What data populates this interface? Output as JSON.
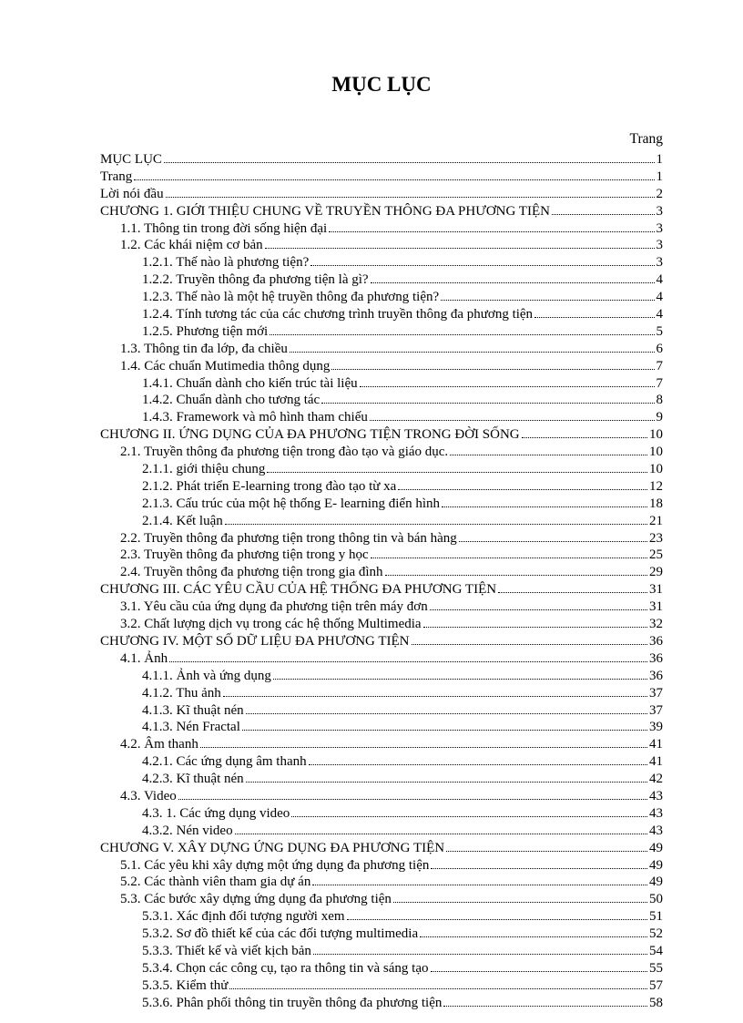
{
  "title": "MỤC LỤC",
  "page_label": "Trang",
  "entries": [
    {
      "label": "MỤC LỤC",
      "page": "1",
      "level": 0
    },
    {
      "label": "Trang ",
      "page": "1",
      "level": 0
    },
    {
      "label": "Lời nói đầu ",
      "page": "2",
      "level": 0
    },
    {
      "label": "CHƯƠNG 1. GIỚI THIỆU CHUNG VỀ TRUYỀN THÔNG ĐA PHƯƠNG TIỆN ",
      "page": "3",
      "level": 0
    },
    {
      "label": "1.1. Thông tin trong đời sống hiện đại ",
      "page": "3",
      "level": 1
    },
    {
      "label": "1.2. Các khái niệm cơ bản ",
      "page": "3",
      "level": 1
    },
    {
      "label": "1.2.1. Thế nào là phương tiện? ",
      "page": "3",
      "level": 2
    },
    {
      "label": "1.2.2. Truyền thông đa phương tiện là gì?",
      "page": "4",
      "level": 2
    },
    {
      "label": "1.2.3. Thế nào là một hệ truyền thông đa phương tiện? ",
      "page": "4",
      "level": 2
    },
    {
      "label": "1.2.4. Tính tương tác của các chương trình truyền thông đa phương tiện ",
      "page": "4",
      "level": 2
    },
    {
      "label": "1.2.5. Phương tiện mới ",
      "page": "5",
      "level": 2
    },
    {
      "label": "1.3. Thông tin đa lớp, đa chiều ",
      "page": "6",
      "level": 1
    },
    {
      "label": "1.4. Các chuẩn Mutimedia thông dụng ",
      "page": "7",
      "level": 1
    },
    {
      "label": "1.4.1. Chuẩn dành cho kiến trúc tài liệu ",
      "page": "7",
      "level": 2
    },
    {
      "label": "1.4.2. Chuẩn dành cho tương tác ",
      "page": "8",
      "level": 2
    },
    {
      "label": "1.4.3. Framework và mô hình tham chiếu ",
      "page": "9",
      "level": 2
    },
    {
      "label": "CHƯƠNG II. ỨNG DỤNG CỦA ĐA PHƯƠNG TIỆN TRONG ĐỜI SỐNG",
      "page": "10",
      "level": 0
    },
    {
      "label": "2.1. Truyền thông đa phương tiện trong đào tạo và giáo dục. ",
      "page": "10",
      "level": 1
    },
    {
      "label": "2.1.1. giới thiệu chung ",
      "page": "10",
      "level": 2
    },
    {
      "label": "2.1.2. Phát triển E-learning trong đào tạo từ xa ",
      "page": "12",
      "level": 2
    },
    {
      "label": "2.1.3. Cấu trúc của một hệ thống E- learning điển hình ",
      "page": "18",
      "level": 2
    },
    {
      "label": "2.1.4. Kết luận ",
      "page": "21",
      "level": 2
    },
    {
      "label": "2.2. Truyền thông đa phương tiện trong thông tin và bán hàng ",
      "page": "23",
      "level": 1
    },
    {
      "label": "2.3. Truyền thông đa phương tiện trong y học",
      "page": "25",
      "level": 1
    },
    {
      "label": "2.4. Truyền thông đa phương tiện trong gia đình ",
      "page": "29",
      "level": 1
    },
    {
      "label": "CHƯƠNG III. CÁC YÊU CẦU CỦA HỆ THỐNG ĐA PHƯƠNG TIỆN ",
      "page": "31",
      "level": 0
    },
    {
      "label": "3.1. Yêu cầu của ứng dụng đa phương tiện trên máy đơn ",
      "page": "31",
      "level": 1
    },
    {
      "label": "3.2. Chất lượng dịch vụ trong các hệ thống Multimedia",
      "page": "32",
      "level": 1
    },
    {
      "label": "CHƯƠNG IV. MỘT SỐ DỮ LIỆU ĐA PHƯƠNG TIỆN",
      "page": "36",
      "level": 0
    },
    {
      "label": "4.1. Ảnh ",
      "page": "36",
      "level": 1
    },
    {
      "label": "4.1.1. Ảnh và ứng dụng ",
      "page": "36",
      "level": 2
    },
    {
      "label": "4.1.2. Thu ảnh ",
      "page": "37",
      "level": 2
    },
    {
      "label": "4.1.3. Kĩ thuật nén ",
      "page": "37",
      "level": 2
    },
    {
      "label": "4.1.3. Nén Fractal ",
      "page": "39",
      "level": 2
    },
    {
      "label": "4.2. Âm thanh",
      "page": "41",
      "level": 1
    },
    {
      "label": "4.2.1. Các ứng dụng âm thanh ",
      "page": "41",
      "level": 2
    },
    {
      "label": "4.2.3. Kĩ thuật nén ",
      "page": "42",
      "level": 2
    },
    {
      "label": "4.3. Video ",
      "page": "43",
      "level": 1
    },
    {
      "label": "4.3. 1.  Các ứng dụng video",
      "page": "43",
      "level": 2
    },
    {
      "label": "4.3.2. Nén video",
      "page": "43",
      "level": 2
    },
    {
      "label": "CHƯƠNG V. XÂY DỰNG ỨNG DỤNG ĐA PHƯƠNG TIỆN ",
      "page": "49",
      "level": 0
    },
    {
      "label": "5.1. Các yêu khi xây dựng một ứng dụng đa phương tiện ",
      "page": "49",
      "level": 1
    },
    {
      "label": "5.2. Các thành viên tham gia dự án",
      "page": "49",
      "level": 1
    },
    {
      "label": "5.3. Các bước xây dựng ứng dụng đa phương tiện ",
      "page": "50",
      "level": 1
    },
    {
      "label": "5.3.1. Xác định đối tượng người xem ",
      "page": "51",
      "level": 2
    },
    {
      "label": "5.3.2. Sơ đồ thiết kế của các đối tượng multimedia ",
      "page": "52",
      "level": 2
    },
    {
      "label": "5.3.3. Thiết kế và viết kịch bản",
      "page": "54",
      "level": 2
    },
    {
      "label": "5.3.4. Chọn các công cụ, tạo ra thông tin và sáng tạo ",
      "page": "55",
      "level": 2
    },
    {
      "label": "5.3.5. Kiểm thử ",
      "page": "57",
      "level": 2
    },
    {
      "label": "5.3.6. Phân phối thông tin truyền thông đa phương tiện ",
      "page": "58",
      "level": 2
    }
  ]
}
